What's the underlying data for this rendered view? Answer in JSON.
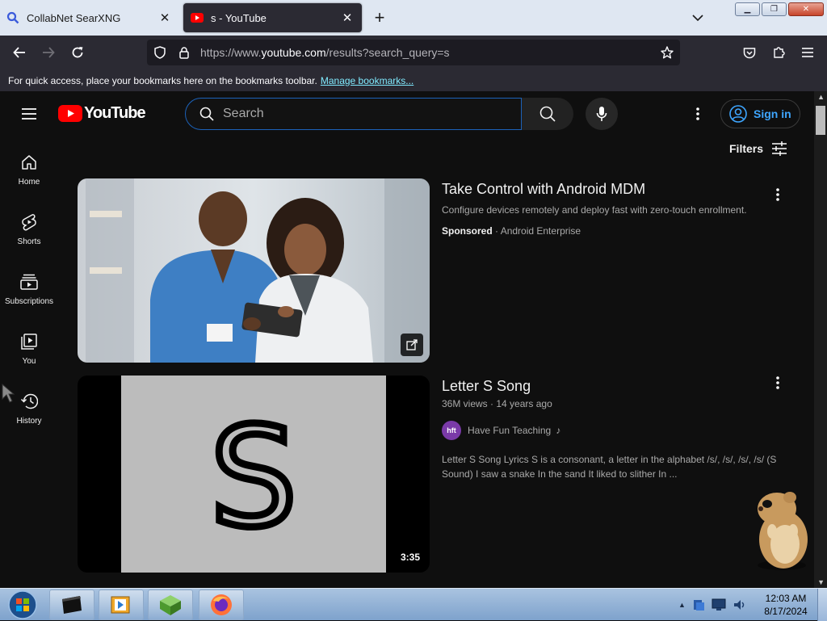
{
  "browser": {
    "tabs": [
      {
        "title": "CollabNet SearXNG",
        "icon": "search-favicon",
        "active": false
      },
      {
        "title": "s - YouTube",
        "icon": "youtube-favicon",
        "active": true
      }
    ],
    "url": {
      "prefix": "https://www.",
      "domain": "youtube.com",
      "path": "/results?search_query=s"
    },
    "bookmarks_bar": {
      "message": "For quick access, place your bookmarks here on the bookmarks toolbar.",
      "link": "Manage bookmarks..."
    }
  },
  "youtube": {
    "logo_text": "YouTube",
    "search_placeholder": "Search",
    "signin_label": "Sign in",
    "filters_label": "Filters",
    "guide": [
      {
        "label": "Home",
        "icon": "home-icon"
      },
      {
        "label": "Shorts",
        "icon": "shorts-icon"
      },
      {
        "label": "Subscriptions",
        "icon": "subscriptions-icon"
      },
      {
        "label": "You",
        "icon": "you-icon"
      },
      {
        "label": "History",
        "icon": "history-icon"
      }
    ],
    "ad": {
      "title": "Take Control with Android MDM",
      "description": "Configure devices remotely and deploy fast with zero-touch enrollment.",
      "sponsored": "Sponsored",
      "advertiser": "Android Enterprise"
    },
    "video1": {
      "title": "Letter S Song",
      "views": "36M views",
      "age": "14 years ago",
      "channel": "Have Fun Teaching",
      "channel_avatar": "hft",
      "description": "Letter S Song Lyrics S is a consonant, a letter in the alphabet /s/, /s/, /s/, /s/ (S Sound) I saw a snake In the sand It liked to slither In ...",
      "duration": "3:35",
      "thumb_letter": "S"
    }
  },
  "taskbar": {
    "time": "12:03 AM",
    "date": "8/17/2024"
  },
  "colors": {
    "accent_blue": "#3ea6ff",
    "yt_red": "#ff0000",
    "search_border": "#1c62b9"
  }
}
